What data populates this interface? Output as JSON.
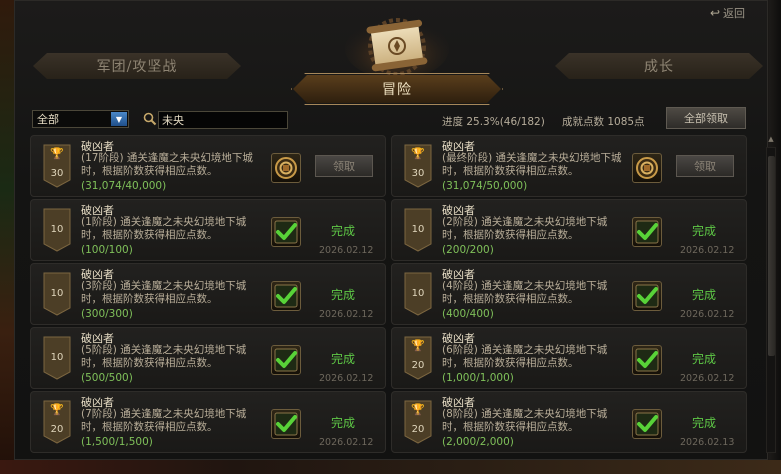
{
  "header": {
    "back_label": "返回",
    "tabs": {
      "legion": "军团/攻坚战",
      "adventure": "冒险",
      "growth": "成长"
    }
  },
  "filters": {
    "category_value": "全部",
    "search_value": "未央"
  },
  "summary": {
    "progress": "进度 25.3%(46/182)",
    "points": "成就点数 1085点",
    "claim_all_label": "全部领取"
  },
  "achievements": [
    {
      "title": "破凶者",
      "desc": "(17阶段) 通关逢魔之未央幻境地下城时，根据阶数获得相应点数。",
      "progress": "(31,074/40,000)",
      "badge": "30",
      "trophy": true,
      "state": "claim",
      "action_label": "领取",
      "date": ""
    },
    {
      "title": "破凶者",
      "desc": "(最终阶段) 通关逢魔之未央幻境地下城时，根据阶数获得相应点数。",
      "progress": "(31,074/50,000)",
      "badge": "30",
      "trophy": true,
      "state": "claim",
      "action_label": "领取",
      "date": ""
    },
    {
      "title": "破凶者",
      "desc": "(1阶段) 通关逢魔之未央幻境地下城时，根据阶数获得相应点数。",
      "progress": "(100/100)",
      "badge": "10",
      "trophy": false,
      "state": "done",
      "action_label": "完成",
      "date": "2026.02.12"
    },
    {
      "title": "破凶者",
      "desc": "(2阶段) 通关逢魔之未央幻境地下城时，根据阶数获得相应点数。",
      "progress": "(200/200)",
      "badge": "10",
      "trophy": false,
      "state": "done",
      "action_label": "完成",
      "date": "2026.02.12"
    },
    {
      "title": "破凶者",
      "desc": "(3阶段) 通关逢魔之未央幻境地下城时，根据阶数获得相应点数。",
      "progress": "(300/300)",
      "badge": "10",
      "trophy": false,
      "state": "done",
      "action_label": "完成",
      "date": "2026.02.12"
    },
    {
      "title": "破凶者",
      "desc": "(4阶段) 通关逢魔之未央幻境地下城时，根据阶数获得相应点数。",
      "progress": "(400/400)",
      "badge": "10",
      "trophy": false,
      "state": "done",
      "action_label": "完成",
      "date": "2026.02.12"
    },
    {
      "title": "破凶者",
      "desc": "(5阶段) 通关逢魔之未央幻境地下城时，根据阶数获得相应点数。",
      "progress": "(500/500)",
      "badge": "10",
      "trophy": false,
      "state": "done",
      "action_label": "完成",
      "date": "2026.02.12"
    },
    {
      "title": "破凶者",
      "desc": "(6阶段) 通关逢魔之未央幻境地下城时，根据阶数获得相应点数。",
      "progress": "(1,000/1,000)",
      "badge": "20",
      "trophy": true,
      "state": "done",
      "action_label": "完成",
      "date": "2026.02.12"
    },
    {
      "title": "破凶者",
      "desc": "(7阶段) 通关逢魔之未央幻境地下城时，根据阶数获得相应点数。",
      "progress": "(1,500/1,500)",
      "badge": "20",
      "trophy": true,
      "state": "done",
      "action_label": "完成",
      "date": "2026.02.12"
    },
    {
      "title": "破凶者",
      "desc": "(8阶段) 通关逢魔之未央幻境地下城时，根据阶数获得相应点数。",
      "progress": "(2,000/2,000)",
      "badge": "20",
      "trophy": true,
      "state": "done",
      "action_label": "完成",
      "date": "2026.02.13"
    }
  ],
  "icons": {
    "back": "return-arrow-icon",
    "search": "magnifier-icon",
    "emblem": "scroll-emblem-icon",
    "claim_item": "gear-medal-icon",
    "done_item": "green-check-icon",
    "trophy": "trophy-icon"
  },
  "colors": {
    "done": "#5ec846",
    "progress": "#7fc05a",
    "accent": "#a6875a"
  }
}
